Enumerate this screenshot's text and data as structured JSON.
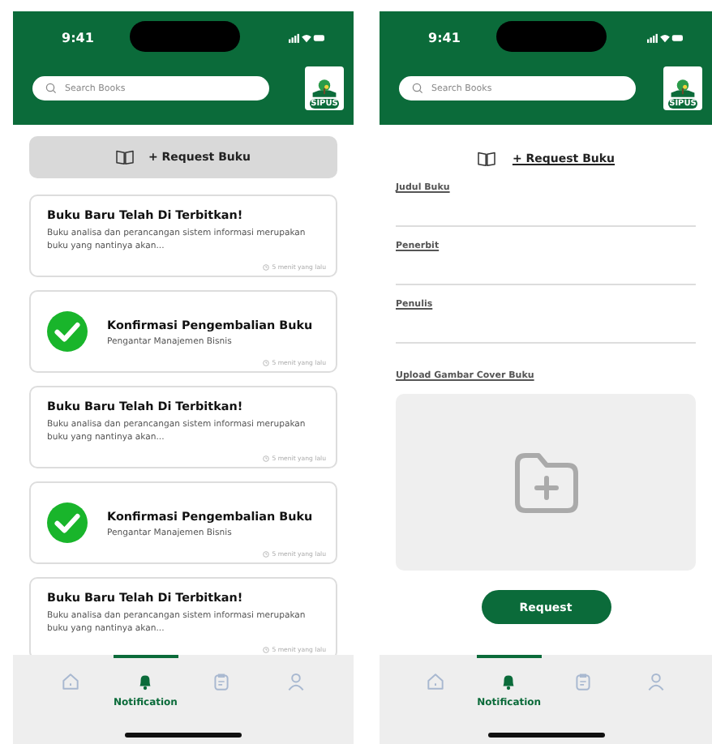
{
  "screens": [
    {
      "kind": "notifications",
      "status_time": "9:41",
      "search": {
        "placeholder": "Search Books"
      },
      "logo": "SIPUS",
      "request_button": "+ Request Buku",
      "notifications": [
        {
          "kind": "published",
          "title": "Buku Baru Telah Di Terbitkan!",
          "text": "Buku analisa dan perancangan sistem informasi merupakan buku yang nantinya akan...",
          "time": "5 menit yang lalu"
        },
        {
          "kind": "confirmation",
          "title": "Konfirmasi Pengembalian Buku",
          "text": "Pengantar Manajemen Bisnis",
          "time": "5 menit yang lalu"
        },
        {
          "kind": "published",
          "title": "Buku Baru Telah Di Terbitkan!",
          "text": "Buku analisa dan perancangan sistem informasi merupakan buku yang nantinya akan...",
          "time": "5 menit yang lalu"
        },
        {
          "kind": "confirmation",
          "title": "Konfirmasi Pengembalian Buku",
          "text": "Pengantar Manajemen Bisnis",
          "time": "5 menit yang lalu"
        },
        {
          "kind": "published",
          "title": "Buku Baru Telah Di Terbitkan!",
          "text": "Buku analisa dan perancangan sistem informasi merupakan buku yang nantinya akan...",
          "time": "5 menit yang lalu"
        }
      ],
      "nav": [
        {
          "kind": "home",
          "selected": false
        },
        {
          "kind": "bell",
          "label": "Notification",
          "selected": true
        },
        {
          "kind": "clipboard",
          "selected": false
        },
        {
          "kind": "user",
          "selected": false
        }
      ]
    },
    {
      "kind": "request_form",
      "status_time": "9:41",
      "search": {
        "placeholder": "Search Books"
      },
      "logo": "SIPUS",
      "heading": "+ Request Buku",
      "fields": [
        {
          "label": "Judul Buku"
        },
        {
          "label": "Penerbit"
        },
        {
          "label": "Penulis"
        }
      ],
      "upload_label": "Upload Gambar Cover Buku",
      "submit_button": "Request",
      "nav": [
        {
          "kind": "home",
          "selected": false
        },
        {
          "kind": "bell",
          "label": "Notification",
          "selected": true
        },
        {
          "kind": "clipboard",
          "selected": false
        },
        {
          "kind": "user",
          "selected": false
        }
      ]
    }
  ]
}
